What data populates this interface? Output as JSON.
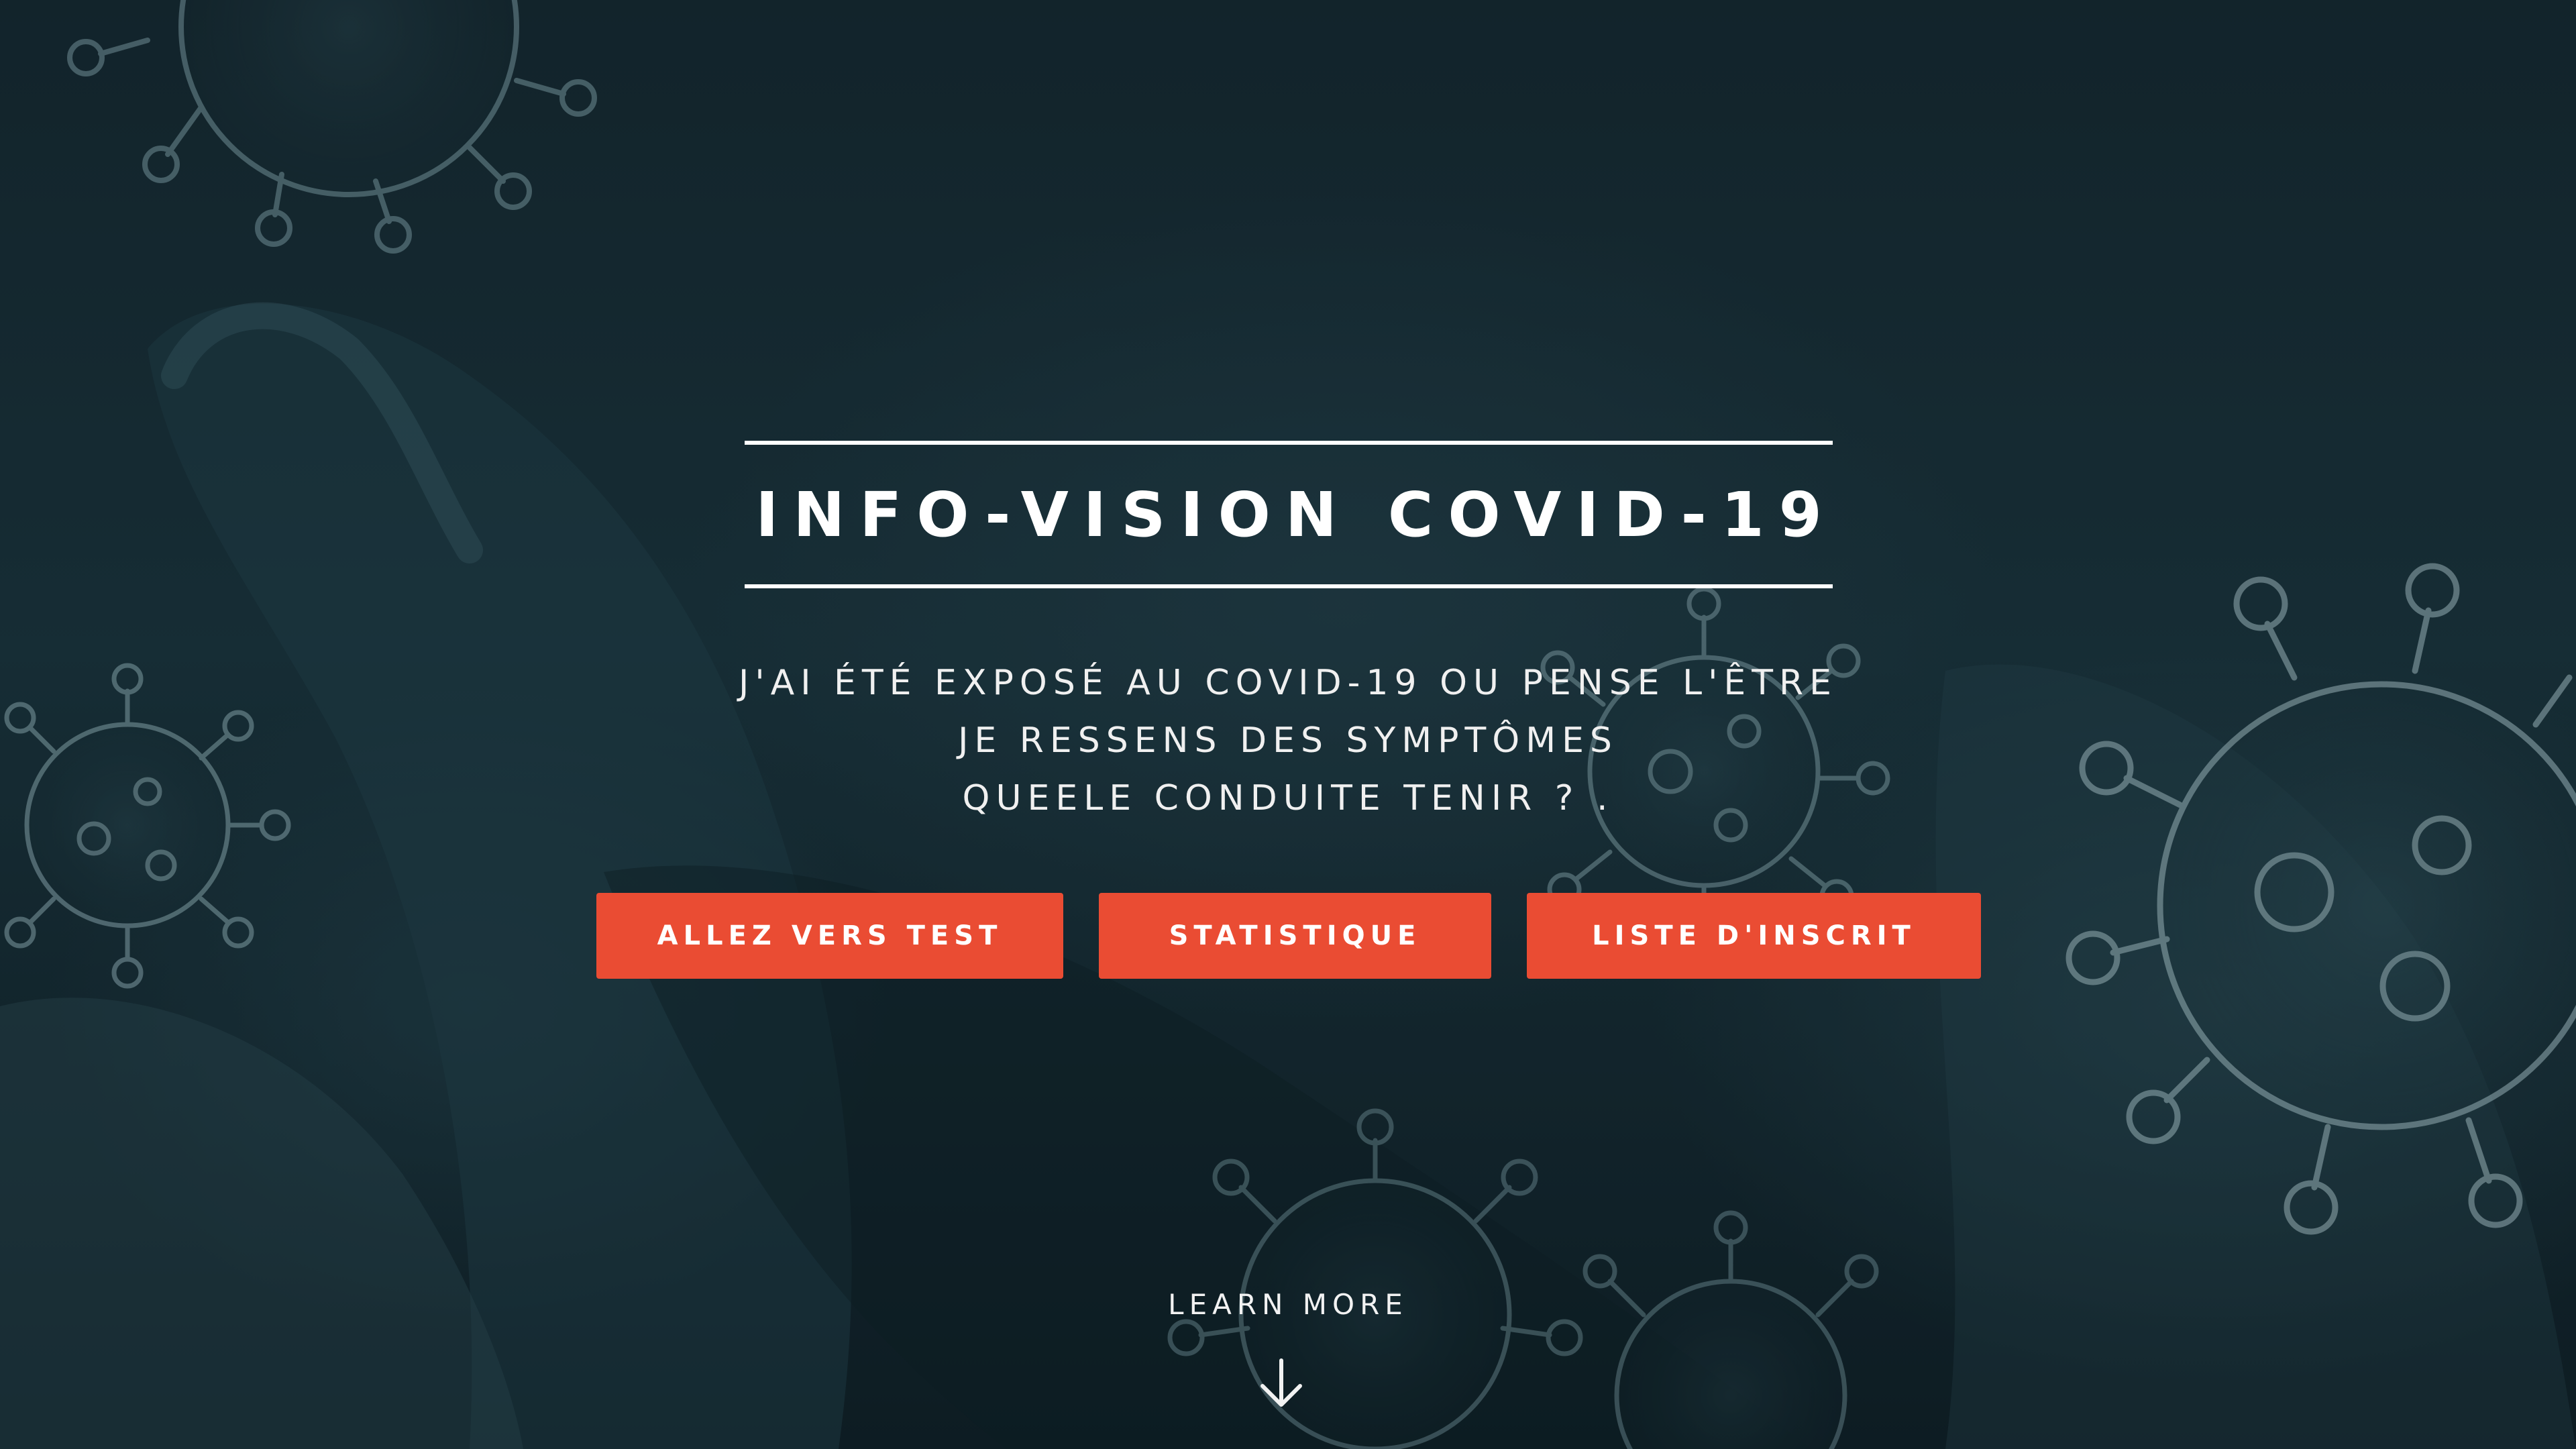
{
  "hero": {
    "title": "INFO-VISION COVID-19",
    "subtitle_lines": [
      "J'AI ÉTÉ EXPOSÉ AU COVID-19 OU PENSE L'ÊTRE",
      "JE RESSENS DES SYMPTÔMES",
      "QUEELE CONDUITE TENIR ? ."
    ],
    "buttons": {
      "test": "ALLEZ VERS TEST",
      "stats": "STATISTIQUE",
      "list": "LISTE D'INSCRIT"
    },
    "learn_more": "LEARN MORE",
    "learn_more_icon": "arrow-down-icon",
    "background_image": "virus-particles-and-hands-photo"
  },
  "colors": {
    "accent": "#ea4c33",
    "text": "#ffffff",
    "background": "#15282f"
  }
}
